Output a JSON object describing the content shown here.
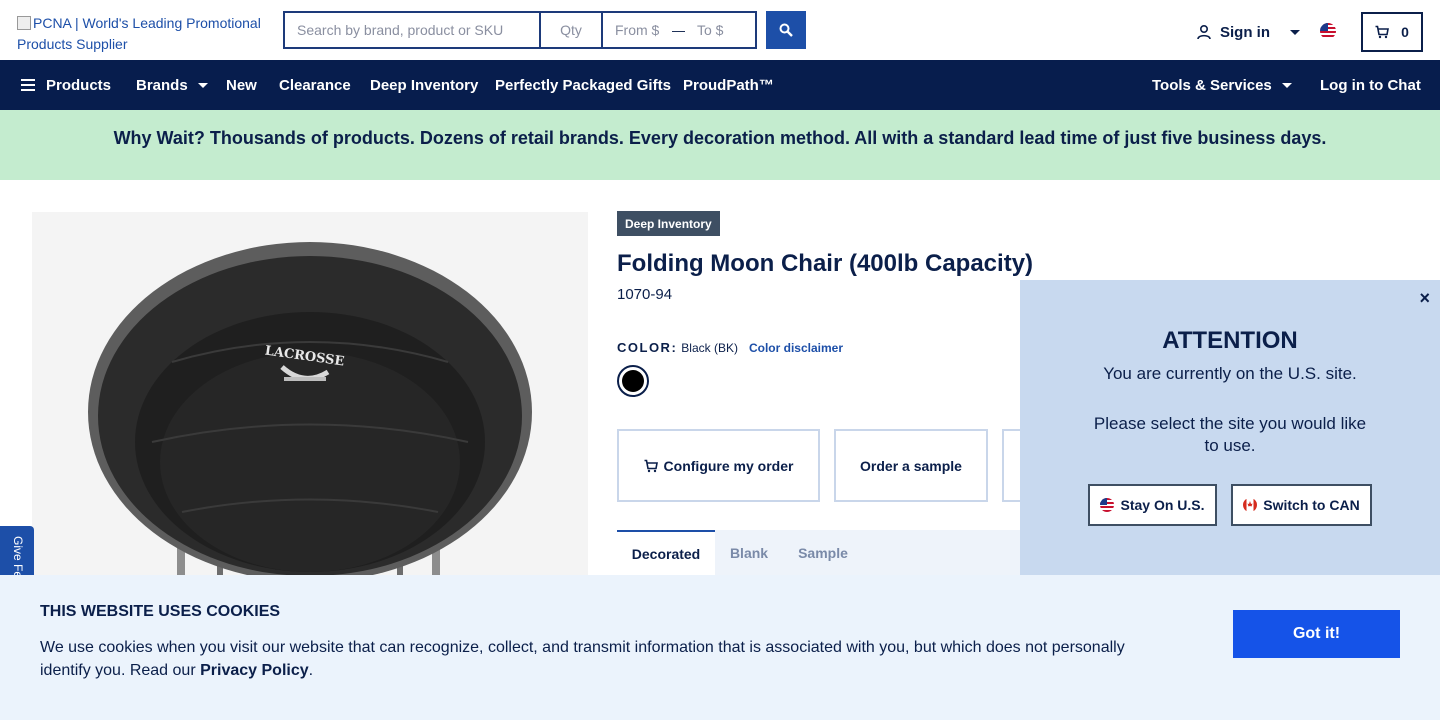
{
  "header": {
    "logo_alt": "PCNA | World's Leading Promotional Products Supplier",
    "search_placeholder": "Search by brand, product or SKU",
    "qty_placeholder": "Qty",
    "from_placeholder": "From $",
    "range_dash": "—",
    "to_placeholder": "To $",
    "signin_label": "Sign in",
    "cart_count": "0"
  },
  "nav": {
    "products": "Products",
    "brands": "Brands",
    "new": "New",
    "clearance": "Clearance",
    "deep_inventory": "Deep Inventory",
    "gifts": "Perfectly Packaged Gifts",
    "proudpath": "ProudPath™",
    "tools": "Tools & Services",
    "chat": "Log in to Chat"
  },
  "banner": {
    "text": "Why Wait? Thousands of products. Dozens of retail brands. Every decoration method. All with a standard lead time of just five business days."
  },
  "product": {
    "badge": "Deep Inventory",
    "title": "Folding Moon Chair (400lb Capacity)",
    "sku": "1070-94",
    "color_label": "COLOR:",
    "color_value": "Black (BK)",
    "color_disclaimer": "Color disclaimer",
    "swatch_color": "#000000",
    "configure_label": "Configure my order",
    "sample_label": "Order a sample",
    "image_text": "LACROSSE"
  },
  "tabs": [
    "Decorated",
    "Blank",
    "Sample"
  ],
  "feedback_label": "Give Feedback",
  "attention": {
    "title": "ATTENTION",
    "line1": "You are currently on the U.S. site.",
    "line2": "Please select the site you would like to use.",
    "stay": "Stay On U.S.",
    "switch": "Switch to CAN",
    "close": "×"
  },
  "cookie": {
    "title": "THIS WEBSITE USES COOKIES",
    "body": "We use cookies when you visit our website that can recognize, collect, and transmit information that is associated with you, but which does not personally identify you. Read our",
    "link": "Privacy Policy",
    "end": ".",
    "button": "Got it!"
  },
  "colors": {
    "navy": "#071d4d",
    "accent_blue": "#1553e8",
    "banner_green": "#c4eccf",
    "modal_bg": "#c8d9ef"
  }
}
